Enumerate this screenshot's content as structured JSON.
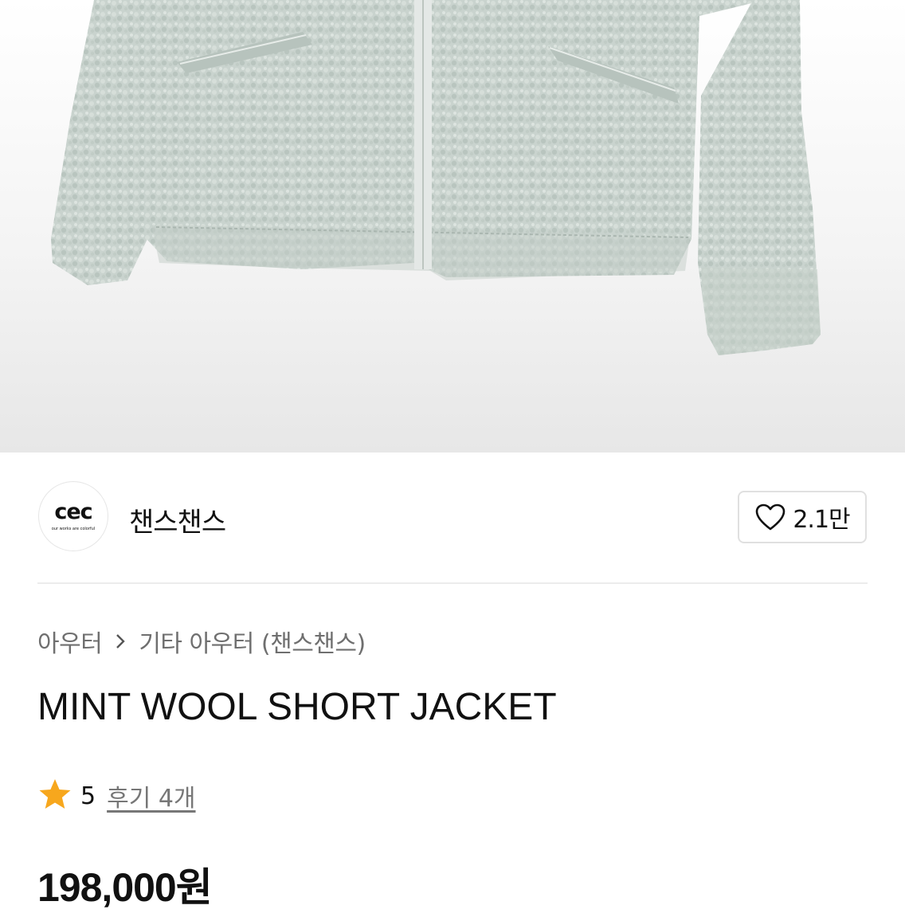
{
  "hero": {
    "image_icon": "product-photo-mint-wool-jacket"
  },
  "seller": {
    "logo_text": "cec",
    "logo_tagline": "our works are colorful",
    "name": "챈스챈스"
  },
  "wishlist": {
    "icon": "heart-outline-icon",
    "count": "2.1만"
  },
  "breadcrumb": {
    "level1": "아우터",
    "separator_icon": "chevron-right-icon",
    "level2": "기타 아우터 (챈스챈스)"
  },
  "product": {
    "title": "MINT WOOL SHORT JACKET"
  },
  "rating": {
    "star_icon": "star-icon",
    "star_color": "#f7a71d",
    "value": "5",
    "review_label": "후기 4개"
  },
  "price": {
    "amount": "198,000원"
  }
}
